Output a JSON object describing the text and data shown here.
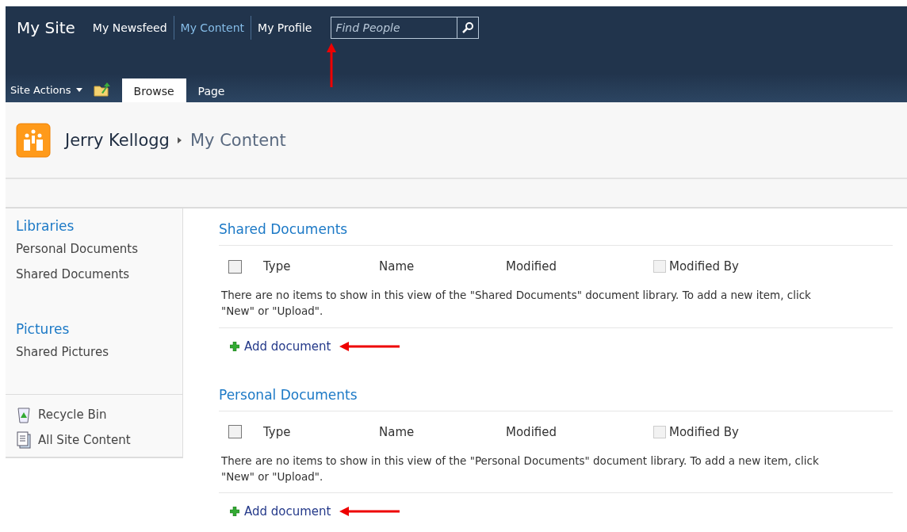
{
  "top_nav": {
    "site_title": "My Site",
    "links": [
      {
        "label": "My Newsfeed",
        "selected": false
      },
      {
        "label": "My Content",
        "selected": true
      },
      {
        "label": "My Profile",
        "selected": false
      }
    ],
    "search": {
      "placeholder": "Find People"
    }
  },
  "ribbon": {
    "site_actions": "Site Actions",
    "tabs": [
      {
        "label": "Browse",
        "selected": true
      },
      {
        "label": "Page",
        "selected": false
      }
    ]
  },
  "breadcrumb": {
    "owner": "Jerry Kellogg",
    "current": "My Content"
  },
  "sidebar": {
    "groups": [
      {
        "heading": "Libraries",
        "items": [
          "Personal Documents",
          "Shared Documents"
        ]
      },
      {
        "heading": "Pictures",
        "items": [
          "Shared Pictures"
        ]
      }
    ],
    "footer_links": [
      {
        "kind": "recycle",
        "label": "Recycle Bin"
      },
      {
        "kind": "content",
        "label": "All Site Content"
      }
    ]
  },
  "libraries": [
    {
      "title": "Shared Documents",
      "select_all_checked": false,
      "modified_by_checkbox_disabled": true,
      "columns": [
        "Type",
        "Name",
        "Modified",
        "Modified By"
      ],
      "empty_message": "There are no items to show in this view of the \"Shared Documents\" document library. To add a new item, click \"New\" or \"Upload\".",
      "add_label": "Add document"
    },
    {
      "title": "Personal Documents",
      "select_all_checked": false,
      "modified_by_checkbox_disabled": true,
      "columns": [
        "Type",
        "Name",
        "Modified",
        "Modified By"
      ],
      "empty_message": "There are no items to show in this view of the \"Personal Documents\" document library. To add a new item, click \"New\" or \"Upload\".",
      "add_label": "Add document"
    }
  ]
}
